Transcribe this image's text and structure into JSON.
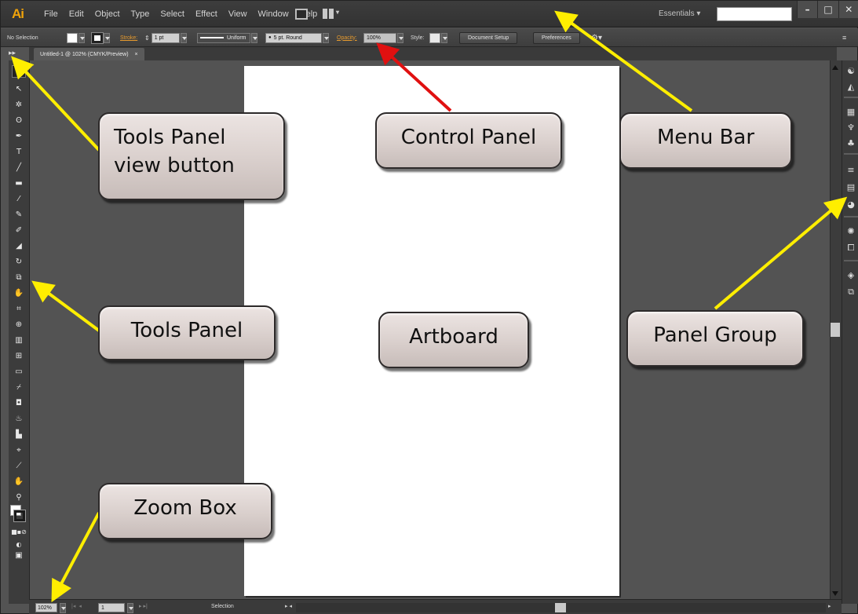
{
  "app": {
    "logo": "Ai"
  },
  "menubar": {
    "items": [
      "File",
      "Edit",
      "Object",
      "Type",
      "Select",
      "Effect",
      "View",
      "Window",
      "Help"
    ],
    "workspace_label": "Essentials",
    "window_controls": [
      "–",
      "□",
      "✕"
    ]
  },
  "control_panel": {
    "selection_label": "No Selection",
    "stroke_label": "Stroke:",
    "stroke_weight": "1 pt",
    "profile_label": "Uniform",
    "brush_label": "5 pt. Round",
    "opacity_label": "Opacity:",
    "opacity_value": "100%",
    "style_label": "Style:",
    "document_setup_button": "Document Setup",
    "preferences_button": "Preferences"
  },
  "document": {
    "tab_label": "Untitled-1 @ 102% (CMYK/Preview)",
    "tab_close": "×"
  },
  "status_bar": {
    "zoom_value": "102%",
    "page_value": "1",
    "status_text": "Selection"
  },
  "callouts": {
    "tools_view_button": "Tools Panel\nview button",
    "control_panel": "Control Panel",
    "menu_bar": "Menu Bar",
    "tools_panel": "Tools Panel",
    "artboard": "Artboard",
    "panel_group": "Panel Group",
    "zoom_box": "Zoom Box"
  },
  "colors": {
    "app_background": "#535353",
    "artboard": "#ffffff",
    "callout_fill": "#d9cfcc",
    "arrow_yellow": "#ffee00",
    "arrow_red": "#e01010",
    "logo_orange": "#f0a30a"
  },
  "icons": {
    "tools": [
      "selection-icon",
      "direct-selection-icon",
      "magic-wand-icon",
      "lasso-icon",
      "pen-icon",
      "type-icon",
      "line-icon",
      "rectangle-icon",
      "paintbrush-icon",
      "pencil-icon",
      "blob-brush-icon",
      "eraser-icon",
      "rotate-icon",
      "scale-icon",
      "warp-icon",
      "free-transform-icon",
      "shape-builder-icon",
      "perspective-grid-icon",
      "mesh-icon",
      "gradient-icon",
      "eyedropper-icon",
      "blend-icon",
      "symbol-sprayer-icon",
      "column-graph-icon",
      "artboard-tool-icon",
      "slice-icon",
      "hand-icon",
      "zoom-icon"
    ],
    "dock": [
      "color-icon",
      "color-guide-icon",
      "swatches-icon",
      "brushes-icon",
      "symbols-icon",
      "stroke-icon",
      "gradient-panel-icon",
      "transparency-icon",
      "appearance-icon",
      "graphic-styles-icon",
      "layers-icon",
      "artboards-panel-icon"
    ]
  }
}
